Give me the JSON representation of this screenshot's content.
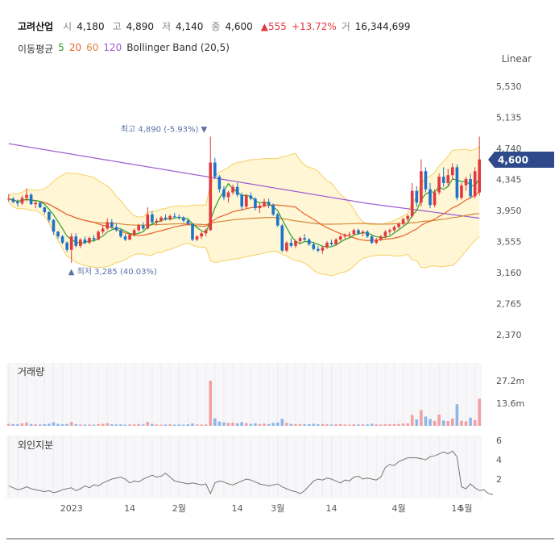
{
  "header": {
    "name": "고려산업",
    "open_label": "시",
    "open": "4,180",
    "high_label": "고",
    "high": "4,890",
    "low_label": "저",
    "low": "4,140",
    "close_label": "종",
    "close": "4,600",
    "change": "▲555",
    "change_pct": "+13.72%",
    "volume_label": "거",
    "volume": "16,344,699"
  },
  "indicators": {
    "ma_label": "이동평균",
    "ma5": "5",
    "ma20": "20",
    "ma60": "60",
    "ma120": "120",
    "bb_label": "Bollinger Band (20,5)"
  },
  "scale_button": "Linear",
  "current_price": "4,600",
  "annotations": {
    "high": "최고 4,890 (-5.93%) ▼",
    "low": "▲ 최저 3,285 (40.03%)"
  },
  "panels": {
    "volume": "거래량",
    "foreign": "외인지분"
  },
  "colors": {
    "up": "#e0393e",
    "down": "#1e73c8",
    "ma5": "#2ca02c",
    "ma20": "#e8632a",
    "ma60": "#d4893a",
    "ma120": "#9b59d0",
    "bb": "#f5d060",
    "bb_fill": "#fff6d6",
    "price_tag": "#2e4a8a"
  },
  "chart_data": {
    "type": "candlestick",
    "price_axis": {
      "ticks": [
        "5,530",
        "5,135",
        "4,740",
        "4,345",
        "3,950",
        "3,555",
        "3,160",
        "2,765",
        "2,370"
      ],
      "ylim": [
        2370,
        5530
      ]
    },
    "volume_axis": {
      "ticks": [
        "27.2m",
        "13.6m"
      ]
    },
    "foreign_axis": {
      "ticks": [
        "6",
        "4",
        "2"
      ],
      "ylim": [
        0,
        6
      ]
    },
    "x_ticks": [
      "2023",
      "14",
      "2월",
      "14",
      "3월",
      "14",
      "4월",
      "14",
      "5월"
    ],
    "ohlc": [
      [
        4100,
        4160,
        4060,
        4100
      ],
      [
        4100,
        4120,
        4040,
        4060
      ],
      [
        4060,
        4090,
        4000,
        4040
      ],
      [
        4040,
        4140,
        4020,
        4110
      ],
      [
        4110,
        4230,
        4060,
        4150
      ],
      [
        4150,
        4170,
        4020,
        4030
      ],
      [
        4030,
        4080,
        3980,
        4050
      ],
      [
        4050,
        4070,
        3980,
        3990
      ],
      [
        3990,
        4000,
        3900,
        3930
      ],
      [
        3930,
        3940,
        3800,
        3830
      ],
      [
        3830,
        3840,
        3640,
        3680
      ],
      [
        3680,
        3690,
        3590,
        3620
      ],
      [
        3620,
        3640,
        3520,
        3540
      ],
      [
        3540,
        3560,
        3420,
        3450
      ],
      [
        3450,
        3660,
        3285,
        3620
      ],
      [
        3620,
        3660,
        3480,
        3500
      ],
      [
        3500,
        3600,
        3470,
        3580
      ],
      [
        3580,
        3620,
        3520,
        3540
      ],
      [
        3540,
        3620,
        3520,
        3600
      ],
      [
        3600,
        3640,
        3560,
        3580
      ],
      [
        3580,
        3700,
        3570,
        3680
      ],
      [
        3680,
        3760,
        3650,
        3720
      ],
      [
        3720,
        3850,
        3700,
        3800
      ],
      [
        3800,
        3840,
        3720,
        3740
      ],
      [
        3740,
        3780,
        3680,
        3700
      ],
      [
        3700,
        3720,
        3600,
        3620
      ],
      [
        3620,
        3650,
        3560,
        3580
      ],
      [
        3580,
        3660,
        3570,
        3640
      ],
      [
        3640,
        3720,
        3620,
        3700
      ],
      [
        3700,
        3780,
        3680,
        3760
      ],
      [
        3760,
        3800,
        3700,
        3720
      ],
      [
        3720,
        3990,
        3710,
        3900
      ],
      [
        3900,
        3940,
        3780,
        3800
      ],
      [
        3800,
        3850,
        3760,
        3820
      ],
      [
        3820,
        3880,
        3800,
        3860
      ],
      [
        3860,
        3900,
        3820,
        3840
      ],
      [
        3840,
        3900,
        3820,
        3880
      ],
      [
        3880,
        3920,
        3850,
        3870
      ],
      [
        3870,
        3900,
        3830,
        3860
      ],
      [
        3860,
        3880,
        3800,
        3820
      ],
      [
        3820,
        3840,
        3760,
        3780
      ],
      [
        3780,
        3790,
        3560,
        3580
      ],
      [
        3580,
        3640,
        3560,
        3620
      ],
      [
        3620,
        3680,
        3590,
        3660
      ],
      [
        3660,
        3720,
        3620,
        3700
      ],
      [
        3700,
        4890,
        3690,
        4560
      ],
      [
        4560,
        4620,
        4350,
        4380
      ],
      [
        4380,
        4400,
        4180,
        4220
      ],
      [
        4220,
        4260,
        4080,
        4120
      ],
      [
        4120,
        4200,
        4050,
        4180
      ],
      [
        4180,
        4280,
        4150,
        4250
      ],
      [
        4250,
        4300,
        4120,
        4150
      ],
      [
        4150,
        4180,
        3960,
        4000
      ],
      [
        4000,
        4160,
        3980,
        4140
      ],
      [
        4140,
        4180,
        4080,
        4100
      ],
      [
        4100,
        4120,
        3950,
        3980
      ],
      [
        3980,
        4040,
        3920,
        4010
      ],
      [
        4010,
        4100,
        3990,
        4060
      ],
      [
        4060,
        4100,
        3980,
        4020
      ],
      [
        4020,
        4040,
        3880,
        3900
      ],
      [
        3900,
        3920,
        3740,
        3760
      ],
      [
        3760,
        3780,
        3420,
        3440
      ],
      [
        3440,
        3560,
        3420,
        3540
      ],
      [
        3540,
        3600,
        3480,
        3500
      ],
      [
        3500,
        3580,
        3470,
        3560
      ],
      [
        3560,
        3620,
        3520,
        3600
      ],
      [
        3600,
        3650,
        3560,
        3580
      ],
      [
        3580,
        3600,
        3500,
        3520
      ],
      [
        3520,
        3540,
        3440,
        3460
      ],
      [
        3460,
        3500,
        3420,
        3440
      ],
      [
        3440,
        3500,
        3400,
        3480
      ],
      [
        3480,
        3560,
        3460,
        3540
      ],
      [
        3540,
        3580,
        3500,
        3520
      ],
      [
        3520,
        3600,
        3500,
        3580
      ],
      [
        3580,
        3640,
        3560,
        3620
      ],
      [
        3620,
        3660,
        3590,
        3640
      ],
      [
        3640,
        3680,
        3610,
        3650
      ],
      [
        3650,
        3720,
        3630,
        3700
      ],
      [
        3700,
        3720,
        3640,
        3660
      ],
      [
        3660,
        3700,
        3620,
        3680
      ],
      [
        3680,
        3700,
        3600,
        3620
      ],
      [
        3620,
        3640,
        3520,
        3540
      ],
      [
        3540,
        3600,
        3520,
        3580
      ],
      [
        3580,
        3640,
        3560,
        3620
      ],
      [
        3620,
        3700,
        3600,
        3680
      ],
      [
        3680,
        3720,
        3640,
        3700
      ],
      [
        3700,
        3760,
        3680,
        3740
      ],
      [
        3740,
        3800,
        3720,
        3780
      ],
      [
        3780,
        3860,
        3760,
        3840
      ],
      [
        3840,
        3900,
        3800,
        3880
      ],
      [
        3880,
        4300,
        3860,
        4200
      ],
      [
        4200,
        4260,
        4000,
        4050
      ],
      [
        4050,
        4600,
        4000,
        4450
      ],
      [
        4450,
        4500,
        4180,
        4220
      ],
      [
        4220,
        4300,
        3980,
        4020
      ],
      [
        4020,
        4220,
        3990,
        4180
      ],
      [
        4180,
        4420,
        4150,
        4380
      ],
      [
        4380,
        4500,
        4250,
        4300
      ],
      [
        4300,
        4480,
        4250,
        4400
      ],
      [
        4400,
        4550,
        4340,
        4500
      ],
      [
        4500,
        4540,
        4080,
        4110
      ],
      [
        4110,
        4300,
        4090,
        4270
      ],
      [
        4270,
        4380,
        4200,
        4350
      ],
      [
        4350,
        4420,
        4100,
        4130
      ],
      [
        4130,
        4500,
        4100,
        4450
      ],
      [
        4180,
        4890,
        4140,
        4600
      ]
    ],
    "volume": [
      1.2,
      1.0,
      0.9,
      1.5,
      2.0,
      1.1,
      0.9,
      0.8,
      1.0,
      1.3,
      2.1,
      1.2,
      0.9,
      1.1,
      2.3,
      1.0,
      0.8,
      0.7,
      0.8,
      0.7,
      1.0,
      1.2,
      1.6,
      0.9,
      0.8,
      0.9,
      0.7,
      0.8,
      0.9,
      1.1,
      0.8,
      2.4,
      1.2,
      0.8,
      0.7,
      0.8,
      0.9,
      0.7,
      0.8,
      0.7,
      0.9,
      1.4,
      0.8,
      0.7,
      0.8,
      27.2,
      4.5,
      2.6,
      2.1,
      1.8,
      1.9,
      1.5,
      2.2,
      1.6,
      1.2,
      1.5,
      1.1,
      1.3,
      1.0,
      1.8,
      2.0,
      4.2,
      1.8,
      1.2,
      1.0,
      1.1,
      0.9,
      1.0,
      1.2,
      1.0,
      1.1,
      0.9,
      0.8,
      0.9,
      1.0,
      0.8,
      0.7,
      0.9,
      0.8,
      0.9,
      0.8,
      1.2,
      0.9,
      0.8,
      1.0,
      0.9,
      1.0,
      1.1,
      1.3,
      1.5,
      6.5,
      3.8,
      9.5,
      5.6,
      4.1,
      3.0,
      6.8,
      3.2,
      2.9,
      4.4,
      13.0,
      3.1,
      2.7,
      4.9,
      3.5,
      16.3
    ],
    "foreign": [
      1.3,
      1.1,
      0.9,
      1.0,
      1.2,
      1.0,
      0.9,
      0.8,
      0.7,
      0.8,
      0.6,
      0.7,
      0.9,
      1.0,
      1.1,
      0.8,
      1.0,
      1.3,
      1.1,
      1.4,
      1.3,
      1.6,
      1.8,
      2.0,
      2.1,
      2.2,
      2.0,
      1.6,
      1.8,
      1.7,
      2.0,
      2.2,
      2.4,
      2.2,
      2.3,
      2.6,
      2.2,
      1.8,
      1.7,
      1.6,
      1.5,
      1.6,
      1.5,
      1.4,
      1.5,
      0.5,
      1.6,
      1.8,
      1.7,
      1.5,
      1.4,
      1.6,
      1.8,
      2.0,
      1.9,
      1.7,
      1.5,
      1.4,
      1.3,
      1.4,
      1.5,
      1.2,
      1.0,
      0.8,
      0.7,
      0.5,
      0.8,
      1.3,
      1.8,
      2.0,
      1.9,
      2.1,
      2.0,
      1.8,
      1.6,
      1.9,
      1.8,
      2.2,
      2.3,
      2.0,
      2.1,
      2.0,
      1.9,
      2.2,
      3.2,
      3.5,
      3.4,
      3.8,
      4.0,
      4.2,
      4.2,
      4.2,
      4.1,
      4.0,
      4.3,
      4.4,
      4.6,
      4.8,
      4.6,
      4.9,
      4.3,
      1.2,
      1.0,
      1.5,
      1.1,
      0.8,
      0.9,
      0.5,
      0.4
    ]
  }
}
